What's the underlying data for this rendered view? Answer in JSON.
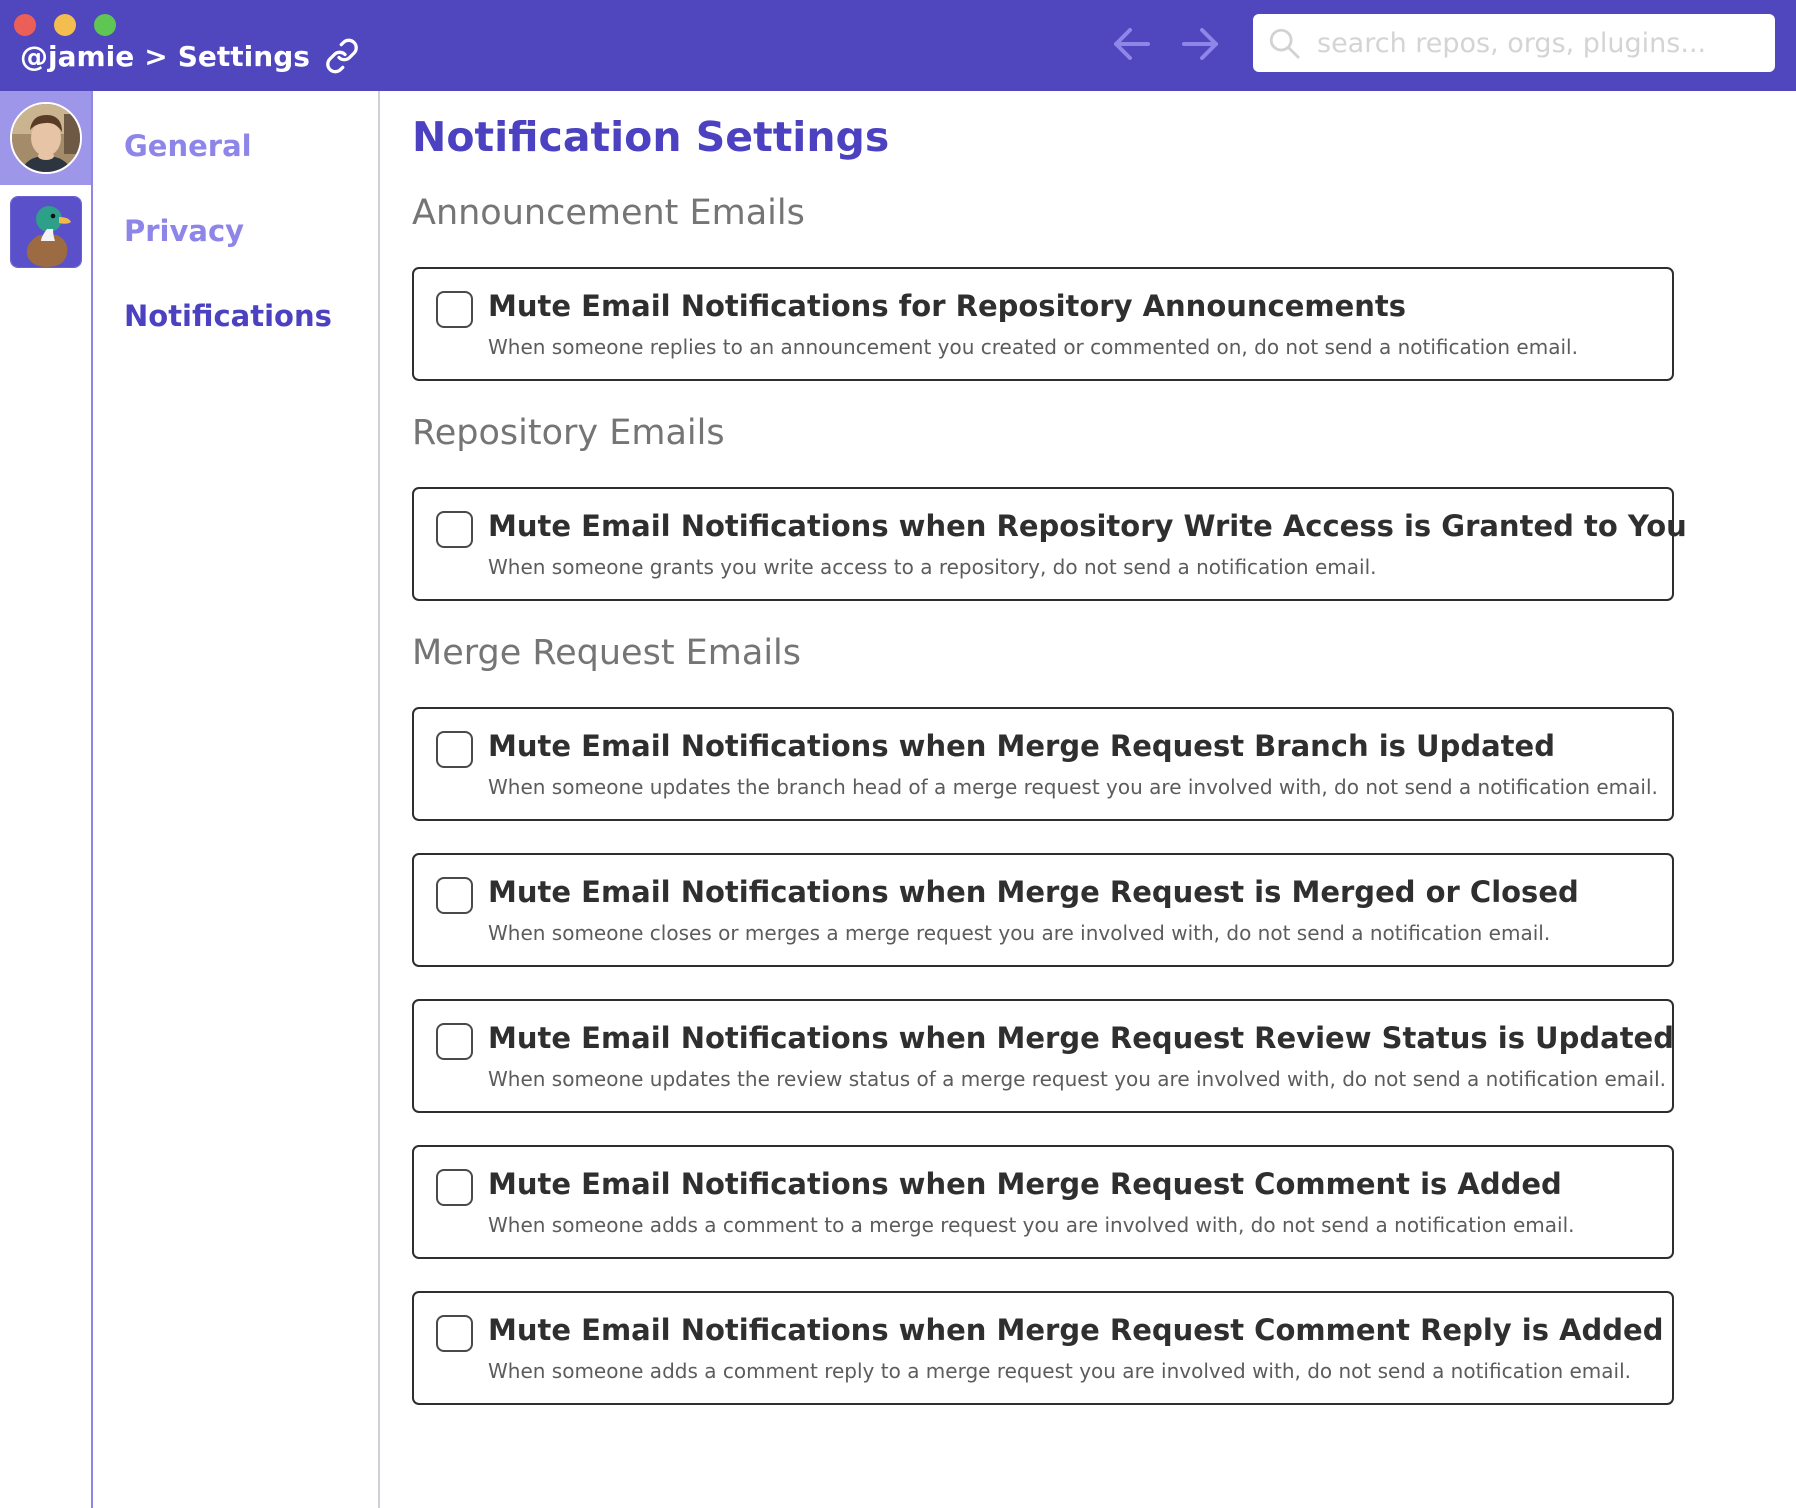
{
  "titlebar": {
    "user": "@jamie",
    "separator": ">",
    "page": "Settings",
    "search_placeholder": "search repos, orgs, plugins...",
    "accent_color": "#5046BE"
  },
  "icons": {
    "link": "link-icon",
    "back": "arrow-left-icon",
    "forward": "arrow-right-icon",
    "search": "search-icon"
  },
  "settings_nav": {
    "items": [
      {
        "label": "General",
        "state": "inactive"
      },
      {
        "label": "Privacy",
        "state": "inactive"
      },
      {
        "label": "Notifications",
        "state": "active"
      }
    ]
  },
  "main": {
    "title": "Notification Settings",
    "sections": [
      {
        "title": "Announcement Emails",
        "options": [
          {
            "label": "Mute Email Notifications for Repository Announcements",
            "description": "When someone replies to an announcement you created or commented on, do not send a notification email.",
            "checked": false
          }
        ]
      },
      {
        "title": "Repository Emails",
        "options": [
          {
            "label": "Mute Email Notifications when Repository Write Access is Granted to You",
            "description": "When someone grants you write access to a repository, do not send a notification email.",
            "checked": false
          }
        ]
      },
      {
        "title": "Merge Request Emails",
        "options": [
          {
            "label": "Mute Email Notifications when Merge Request Branch is Updated",
            "description": "When someone updates the branch head of a merge request you are involved with, do not send a notification email.",
            "checked": false
          },
          {
            "label": "Mute Email Notifications when Merge Request is Merged or Closed",
            "description": "When someone closes or merges a merge request you are involved with, do not send a notification email.",
            "checked": false
          },
          {
            "label": "Mute Email Notifications when Merge Request Review Status is Updated",
            "description": "When someone updates the review status of a merge request you are involved with, do not send a notification email.",
            "checked": false
          },
          {
            "label": "Mute Email Notifications when Merge Request Comment is Added",
            "description": "When someone adds a comment to a merge request you are involved with, do not send a notification email.",
            "checked": false
          },
          {
            "label": "Mute Email Notifications when Merge Request Comment Reply is Added",
            "description": "When someone adds a comment reply to a merge request you are involved with, do not send a notification email.",
            "checked": false
          }
        ]
      }
    ]
  }
}
